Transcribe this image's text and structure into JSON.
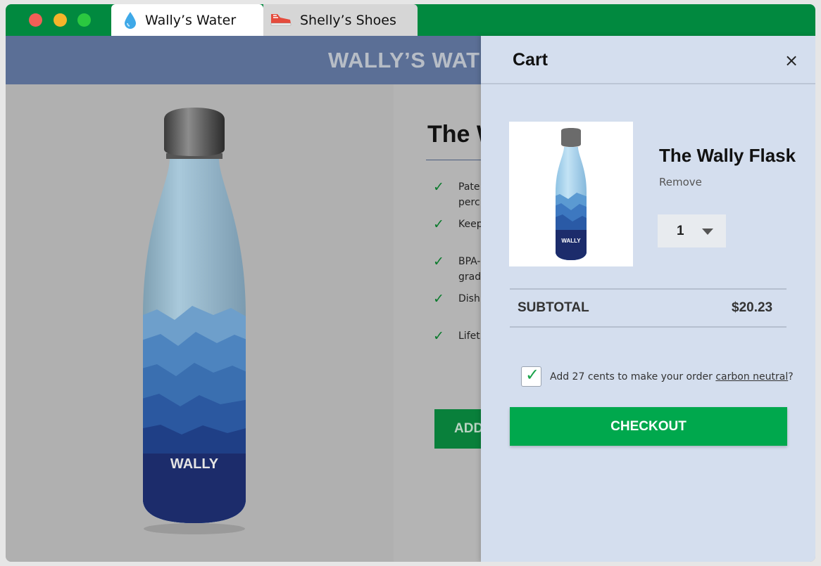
{
  "browser": {
    "tabs": [
      {
        "label": "Wally’s Water",
        "icon": "water-drop-icon",
        "active": true
      },
      {
        "label": "Shelly’s Shoes",
        "icon": "sneaker-icon",
        "active": false
      }
    ]
  },
  "store": {
    "title": "WALLY’S WATER",
    "product_name_visible": "The W",
    "features": [
      "Pate\nperc",
      "Keep",
      "BPA-\ngrad",
      "Dish",
      "Lifet"
    ],
    "add_button_visible": "ADD",
    "bottle_brand": "WALLY"
  },
  "cart": {
    "title": "Cart",
    "close_glyph": "×",
    "item": {
      "name": "The Wally Flask",
      "remove_label": "Remove",
      "quantity": "1",
      "thumb_brand": "WALLY"
    },
    "subtotal_label": "SUBTOTAL",
    "subtotal_value": "$20.23",
    "carbon": {
      "checked": true,
      "text_before": "Add 27 cents to make your order ",
      "link": "carbon neutral",
      "text_after": "?"
    },
    "checkout_label": "CHECKOUT"
  },
  "colors": {
    "titlebar": "#01893f",
    "cart_bg": "#d4deee",
    "checkout": "#00a84d",
    "header": "#5b6f96"
  }
}
